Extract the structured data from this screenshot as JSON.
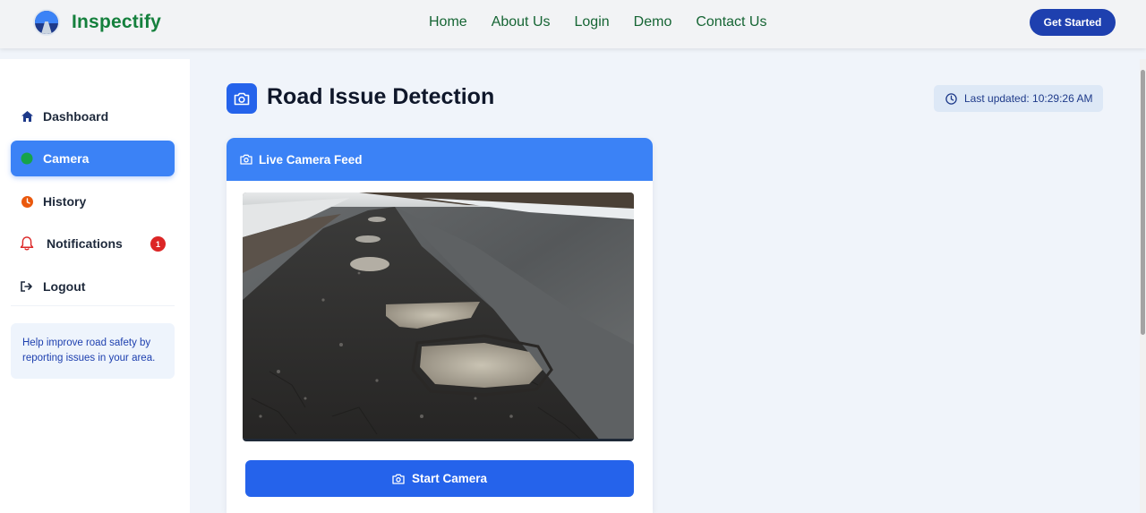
{
  "nav": {
    "brand": "Inspectify",
    "links": [
      "Home",
      "About Us",
      "Login",
      "Demo",
      "Contact Us"
    ],
    "cta": "Get Started"
  },
  "sidebar": {
    "items": [
      {
        "label": "Dashboard",
        "icon": "home-icon"
      },
      {
        "label": "Camera",
        "icon": "camera-dot-icon",
        "active": true
      },
      {
        "label": "History",
        "icon": "clock-icon"
      },
      {
        "label": "Notifications",
        "icon": "bell-icon",
        "badge": "1"
      },
      {
        "label": "Logout",
        "icon": "logout-icon"
      }
    ],
    "help_text": "Help improve road safety by reporting issues in your area."
  },
  "main": {
    "title": "Road Issue Detection",
    "last_updated": "Last updated: 10:29:26 AM",
    "card": {
      "header": "Live Camera Feed",
      "button": "Start Camera"
    }
  },
  "colors": {
    "brand_green": "#15803d",
    "primary_blue": "#2563eb",
    "header_blue": "#3b82f6",
    "badge_red": "#dc2626"
  }
}
